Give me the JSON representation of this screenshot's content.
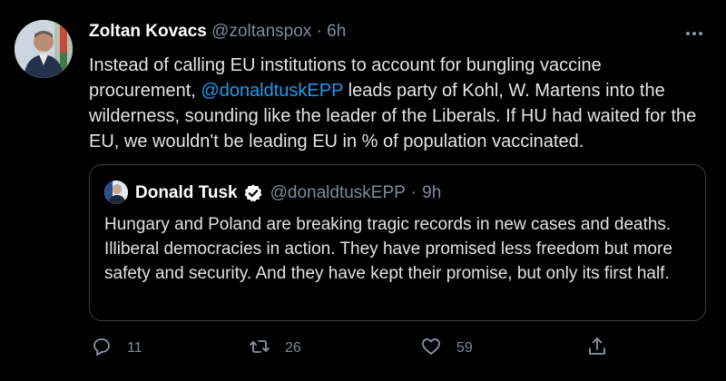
{
  "tweet": {
    "author_name": "Zoltan Kovacs",
    "handle": "@zoltanspox",
    "separator": "·",
    "time": "6h",
    "text_part1": "Instead of calling EU institutions to account for bungling vaccine procurement, ",
    "mention": "@donaldtuskEPP",
    "text_part2": " leads party of Kohl, W. Martens into the wilderness, sounding like the leader of the Liberals. If HU had waited for the EU, we wouldn't be leading EU in % of population vaccinated."
  },
  "quoted": {
    "author_name": "Donald Tusk",
    "verified": true,
    "handle": "@donaldtuskEPP",
    "separator": "·",
    "time": "9h",
    "text": "Hungary and Poland are breaking tragic records in new cases and deaths. Illiberal democracies in action. They have promised less freedom but more safety and security. And they have kept their promise, but only its first half."
  },
  "actions": {
    "reply_count": "11",
    "retweet_count": "26",
    "like_count": "59"
  },
  "colors": {
    "background": "#000000",
    "accent": "#1d9bf0",
    "muted": "#7c8b98",
    "border": "#3a3f44"
  },
  "icons": [
    "more-icon",
    "verified-badge-icon",
    "reply-icon",
    "retweet-icon",
    "like-icon",
    "share-icon"
  ]
}
